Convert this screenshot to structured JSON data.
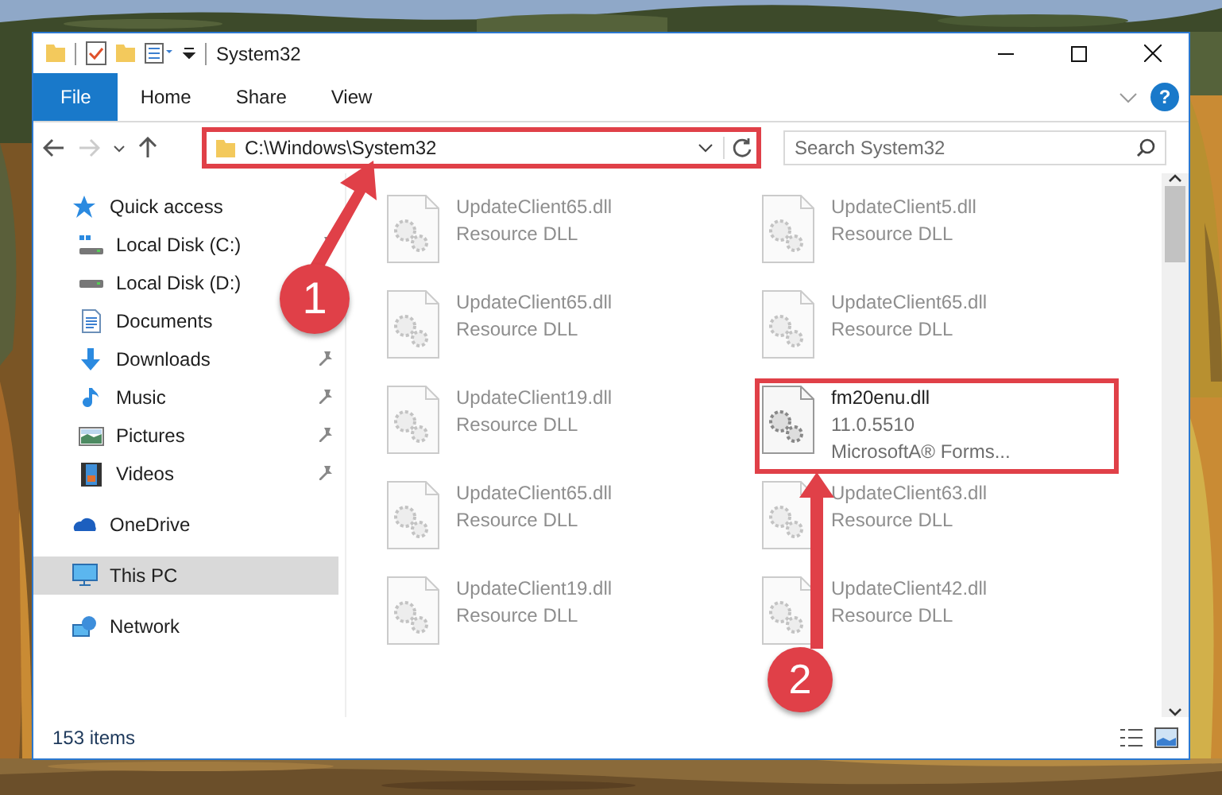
{
  "window": {
    "title": "System32"
  },
  "ribbon": {
    "tabs": [
      {
        "label": "File",
        "selected": true
      },
      {
        "label": "Home",
        "selected": false
      },
      {
        "label": "Share",
        "selected": false
      },
      {
        "label": "View",
        "selected": false
      }
    ],
    "help": "?"
  },
  "address_bar": {
    "path": "C:\\Windows\\System32",
    "highlighted": true
  },
  "search": {
    "placeholder": "Search System32"
  },
  "sidebar": {
    "items": [
      {
        "label": "Quick access",
        "kind": "star",
        "selected": false,
        "children": [
          {
            "label": "Local Disk (C:)",
            "kind": "windows-drive",
            "pinned": true,
            "selected": false
          },
          {
            "label": "Local Disk (D:)",
            "kind": "drive",
            "selected": false
          },
          {
            "label": "Documents",
            "kind": "documents",
            "selected": false
          },
          {
            "label": "Downloads",
            "kind": "downloads",
            "pinned": true,
            "selected": false
          },
          {
            "label": "Music",
            "kind": "music",
            "pinned": true,
            "selected": false
          },
          {
            "label": "Pictures",
            "kind": "pictures",
            "pinned": true,
            "selected": false
          },
          {
            "label": "Videos",
            "kind": "videos",
            "pinned": true,
            "selected": false
          }
        ]
      },
      {
        "label": "OneDrive",
        "kind": "cloud",
        "selected": false
      },
      {
        "label": "This PC",
        "kind": "pc",
        "selected": true
      },
      {
        "label": "Network",
        "kind": "network",
        "selected": false
      }
    ]
  },
  "files": [
    {
      "lines": [
        "UpdateClient65.dll",
        "Resource DLL"
      ],
      "blurred": true,
      "highlighted": false
    },
    {
      "lines": [
        "UpdateClient5.dll",
        "Resource DLL"
      ],
      "blurred": true,
      "highlighted": false
    },
    {
      "lines": [
        "UpdateClient65.dll",
        "Resource DLL"
      ],
      "blurred": true,
      "highlighted": false
    },
    {
      "lines": [
        "UpdateClient65.dll",
        "Resource DLL"
      ],
      "blurred": true,
      "highlighted": false
    },
    {
      "lines": [
        "UpdateClient19.dll",
        "Resource DLL"
      ],
      "blurred": true,
      "highlighted": false
    },
    {
      "lines": [
        "fm20enu.dll",
        "11.0.5510",
        "MicrosoftA® Forms..."
      ],
      "blurred": false,
      "highlighted": true
    },
    {
      "lines": [
        "UpdateClient65.dll",
        "Resource DLL"
      ],
      "blurred": true,
      "highlighted": false
    },
    {
      "lines": [
        "UpdateClient63.dll",
        "Resource DLL"
      ],
      "blurred": true,
      "highlighted": false
    },
    {
      "lines": [
        "UpdateClient19.dll",
        "Resource DLL"
      ],
      "blurred": true,
      "highlighted": false
    },
    {
      "lines": [
        "UpdateClient42.dll",
        "Resource DLL"
      ],
      "blurred": true,
      "highlighted": false
    }
  ],
  "annotations": [
    {
      "label": "1"
    },
    {
      "label": "2"
    }
  ],
  "status_bar": {
    "count": "153 items"
  }
}
